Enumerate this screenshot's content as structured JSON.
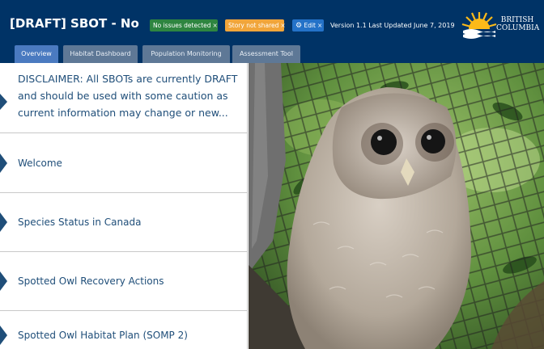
{
  "header": {
    "title": "[DRAFT] SBOT - North",
    "badges": [
      {
        "label": "No issues detected",
        "close": "×"
      },
      {
        "label": "Story not shared",
        "close": "×"
      },
      {
        "label": "Edit",
        "close": "×"
      }
    ],
    "version": "Version 1.1 Last Updated June 7, 2019",
    "logo": {
      "line1": "BRITISH",
      "line2": "COLUMBIA"
    }
  },
  "tabs": [
    {
      "label": "Overview",
      "active": true
    },
    {
      "label": "Habitat Dashboard",
      "active": false
    },
    {
      "label": "Population Monitoring",
      "active": false
    },
    {
      "label": "Assessment Tool",
      "active": false
    }
  ],
  "sidebar": {
    "sections": [
      {
        "label": "DISCLAIMER: All SBOTs are currently DRAFT and should be used with some caution as current information may change or new..."
      },
      {
        "label": "Welcome"
      },
      {
        "label": "Species Status in Canada"
      },
      {
        "label": "Spotted Owl Recovery Actions"
      },
      {
        "label": "Spotted Owl Habitat Plan (SOMP 2)"
      }
    ]
  },
  "colors": {
    "header": "#003366",
    "badge_ok": "#2e8540",
    "badge_warn": "#f1a53a",
    "badge_edit": "#2472c8",
    "accent_text": "#1f4e79"
  },
  "icons": [
    "gear-icon",
    "bc-sun-logo",
    "chevron-right-icon"
  ]
}
